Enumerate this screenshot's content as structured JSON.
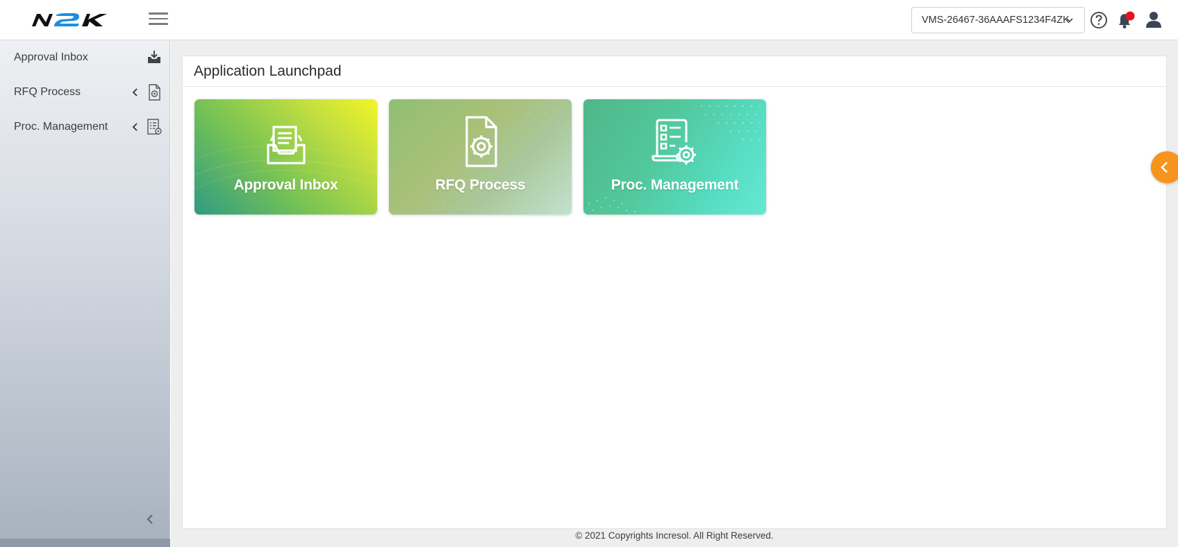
{
  "header": {
    "logo_text": "N2K",
    "environment_selector": {
      "value": "VMS-26467-36AAAFS1234F4ZK"
    },
    "icons": [
      "menu-icon",
      "help-icon",
      "bell-icon",
      "user-icon"
    ],
    "notification_badge_color": "#e8141b"
  },
  "sidebar": {
    "items": [
      {
        "label": "Approval Inbox",
        "icon": "inbox-download-icon",
        "expandable": false
      },
      {
        "label": "RFQ Process",
        "icon": "document-gear-icon",
        "expandable": true
      },
      {
        "label": "Proc. Management",
        "icon": "list-gear-icon",
        "expandable": true
      }
    ]
  },
  "main": {
    "title": "Application Launchpad",
    "tiles": [
      {
        "label": "Approval Inbox",
        "icon": "inbox-tray-icon"
      },
      {
        "label": "RFQ Process",
        "icon": "document-gear-icon"
      },
      {
        "label": "Proc. Management",
        "icon": "checklist-gear-icon"
      }
    ]
  },
  "footer": {
    "text": "© 2021 Copyrights Incresol. All Right Reserved."
  },
  "colors": {
    "accent_orange": "#f7941d",
    "logo_blue": "#1a8fe0",
    "sidebar_gradient_top": "#eef0f3",
    "sidebar_gradient_bottom": "#a7b1bf"
  }
}
